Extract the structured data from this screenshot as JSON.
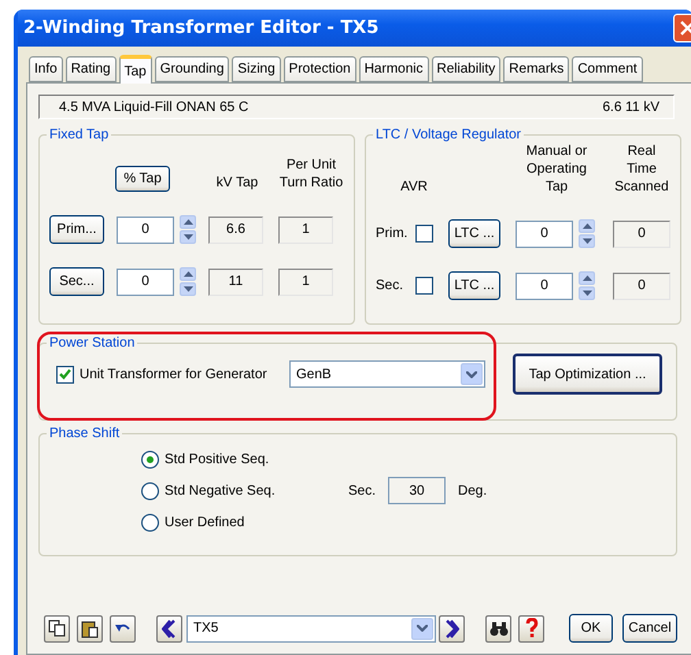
{
  "window": {
    "title": "2-Winding Transformer Editor - TX5"
  },
  "tabs": [
    {
      "label": "Info",
      "selected": false
    },
    {
      "label": "Rating",
      "selected": false
    },
    {
      "label": "Tap",
      "selected": true
    },
    {
      "label": "Grounding",
      "selected": false
    },
    {
      "label": "Sizing",
      "selected": false
    },
    {
      "label": "Protection",
      "selected": false
    },
    {
      "label": "Harmonic",
      "selected": false
    },
    {
      "label": "Reliability",
      "selected": false
    },
    {
      "label": "Remarks",
      "selected": false
    },
    {
      "label": "Comment",
      "selected": false
    }
  ],
  "info_bar": {
    "left": "4.5 MVA  Liquid-Fill  ONAN  65 C",
    "right": "6.6   11 kV"
  },
  "fixed_tap": {
    "title": "Fixed Tap",
    "percent_tap_button": "% Tap",
    "headers": [
      "kV Tap",
      "Per Unit Turn Ratio"
    ],
    "rows": [
      {
        "button": "Prim...",
        "tap": "0",
        "kv": "6.6",
        "ratio": "1"
      },
      {
        "button": "Sec...",
        "tap": "0",
        "kv": "11",
        "ratio": "1"
      }
    ]
  },
  "ltc": {
    "title": "LTC / Voltage Regulator",
    "headers": [
      "AVR",
      "Manual or Operating Tap",
      "Real Time Scanned"
    ],
    "rows": [
      {
        "label": "Prim.",
        "avr_checked": false,
        "button": "LTC ...",
        "tap": "0",
        "scanned": "0"
      },
      {
        "label": "Sec.",
        "avr_checked": false,
        "button": "LTC ...",
        "tap": "0",
        "scanned": "0"
      }
    ]
  },
  "power_station": {
    "title": "Power Station",
    "unit_transformer": {
      "label": "Unit Transformer for Generator",
      "checked": true
    },
    "generator": "GenB",
    "button": "Tap Optimization ..."
  },
  "phase_shift": {
    "title": "Phase Shift",
    "options": [
      {
        "label": "Std Positive Seq.",
        "selected": true
      },
      {
        "label": "Std Negative Seq.",
        "selected": false
      },
      {
        "label": "User Defined",
        "selected": false
      }
    ],
    "sec_label": "Sec.",
    "sec_value": "30",
    "unit": "Deg."
  },
  "footer": {
    "element": "TX5",
    "ok": "OK",
    "cancel": "Cancel"
  }
}
